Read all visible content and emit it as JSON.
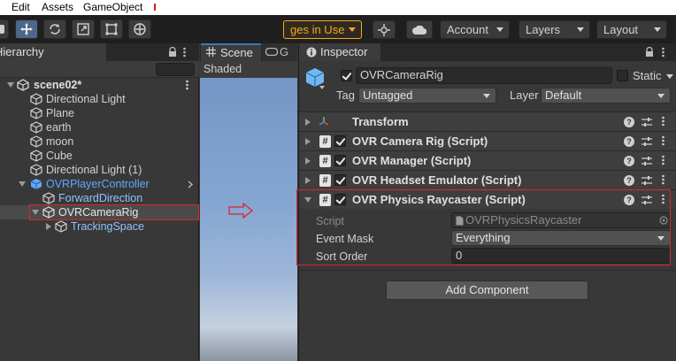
{
  "menubar": {
    "items": [
      "Edit",
      "Assets",
      "GameObject"
    ]
  },
  "toolbar": {
    "packages_label": "ges in Use",
    "account_label": "Account",
    "layers_label": "Layers",
    "layout_label": "Layout"
  },
  "hierarchy": {
    "tab_label": "Hierarchy",
    "scene_name": "scene02*",
    "items": [
      {
        "label": "Directional Light"
      },
      {
        "label": "Plane"
      },
      {
        "label": "earth"
      },
      {
        "label": "moon"
      },
      {
        "label": "Cube"
      },
      {
        "label": "Directional Light (1)"
      },
      {
        "label": "OVRPlayerController"
      },
      {
        "label": "ForwardDirection"
      },
      {
        "label": "OVRCameraRig"
      },
      {
        "label": "TrackingSpace"
      }
    ]
  },
  "scene": {
    "tab_label": "Scene",
    "tab2_label": "G",
    "shading_label": "Shaded"
  },
  "inspector": {
    "tab_label": "Inspector",
    "object_name": "OVRCameraRig",
    "static_label": "Static",
    "tag_label": "Tag",
    "tag_value": "Untagged",
    "layer_label": "Layer",
    "layer_value": "Default",
    "components": [
      {
        "title": "Transform"
      },
      {
        "title": "OVR Camera Rig (Script)"
      },
      {
        "title": "OVR Manager (Script)"
      },
      {
        "title": "OVR Headset Emulator (Script)"
      },
      {
        "title": "OVR Physics Raycaster (Script)"
      }
    ],
    "script_label": "Script",
    "script_value": "OVRPhysicsRaycaster",
    "event_mask_label": "Event Mask",
    "event_mask_value": "Everything",
    "sort_order_label": "Sort Order",
    "sort_order_value": "0",
    "add_component_label": "Add Component"
  },
  "colors": {
    "highlight_box": "#d62828",
    "prefab_blue": "#5ea8ff",
    "toolbar_accent": "#f5a623"
  }
}
